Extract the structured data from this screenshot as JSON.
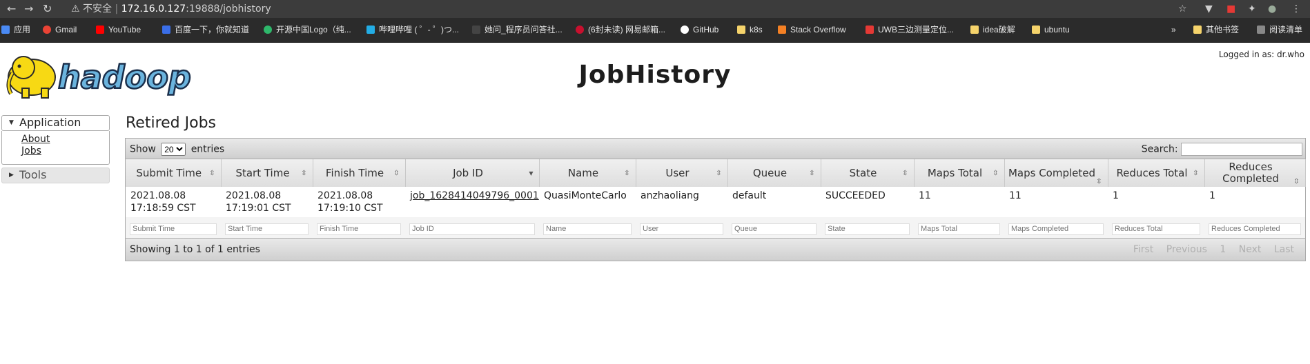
{
  "browser": {
    "security": "不安全",
    "url_host": "172.16.0.127",
    "url_rest": ":19888/jobhistory"
  },
  "bookmarks": [
    {
      "label": "应用",
      "color": "#4a8af4"
    },
    {
      "label": "Gmail",
      "color": "#ea4335"
    },
    {
      "label": "YouTube",
      "color": "#ff0000"
    },
    {
      "label": "百度一下，你就知道",
      "color": "#3a6ee8"
    },
    {
      "label": "开源中国Logo（纯...",
      "color": "#2eb86b"
    },
    {
      "label": "哔哩哔哩 ( ゜- ゜)つ...",
      "color": "#23ade5"
    },
    {
      "label": "她问_程序员问答社...",
      "color": "#444444"
    },
    {
      "label": "(6封未读) 网易邮箱...",
      "color": "#c8102e"
    },
    {
      "label": "GitHub",
      "color": "#ffffff"
    },
    {
      "label": "k8s",
      "color": "#f5d36b"
    },
    {
      "label": "Stack Overflow",
      "color": "#f48024"
    },
    {
      "label": "UWB三边测量定位...",
      "color": "#e53935"
    },
    {
      "label": "idea破解",
      "color": "#f5d36b"
    },
    {
      "label": "ubuntu",
      "color": "#f5d36b"
    },
    {
      "label": "»",
      "color": "transparent"
    },
    {
      "label": "其他书签",
      "color": "#f5d36b"
    },
    {
      "label": "阅读清单",
      "color": "#888888"
    }
  ],
  "header": {
    "logo_text": "hadoop",
    "title": "JobHistory",
    "logged_in": "Logged in as: dr.who"
  },
  "sidebar": {
    "application": "Application",
    "about": "About",
    "jobs": "Jobs",
    "tools": "Tools"
  },
  "section_title": "Retired Jobs",
  "table": {
    "show": "Show",
    "entries_select": "20",
    "entries": "entries",
    "search_label": "Search:",
    "columns": [
      "Submit Time",
      "Start Time",
      "Finish Time",
      "Job ID",
      "Name",
      "User",
      "Queue",
      "State",
      "Maps Total",
      "Maps Completed",
      "Reduces Total",
      "Reduces Completed"
    ],
    "rows": [
      {
        "submit": "2021.08.08 17:18:59 CST",
        "start": "2021.08.08 17:19:01 CST",
        "finish": "2021.08.08 17:19:10 CST",
        "job_id": "job_1628414049796_0001",
        "name": "QuasiMonteCarlo",
        "user": "anzhaoliang",
        "queue": "default",
        "state": "SUCCEEDED",
        "maps_total": "11",
        "maps_completed": "11",
        "reduces_total": "1",
        "reduces_completed": "1"
      }
    ],
    "info": "Showing 1 to 1 of 1 entries",
    "pager": {
      "first": "First",
      "previous": "Previous",
      "page": "1",
      "next": "Next",
      "last": "Last"
    }
  }
}
